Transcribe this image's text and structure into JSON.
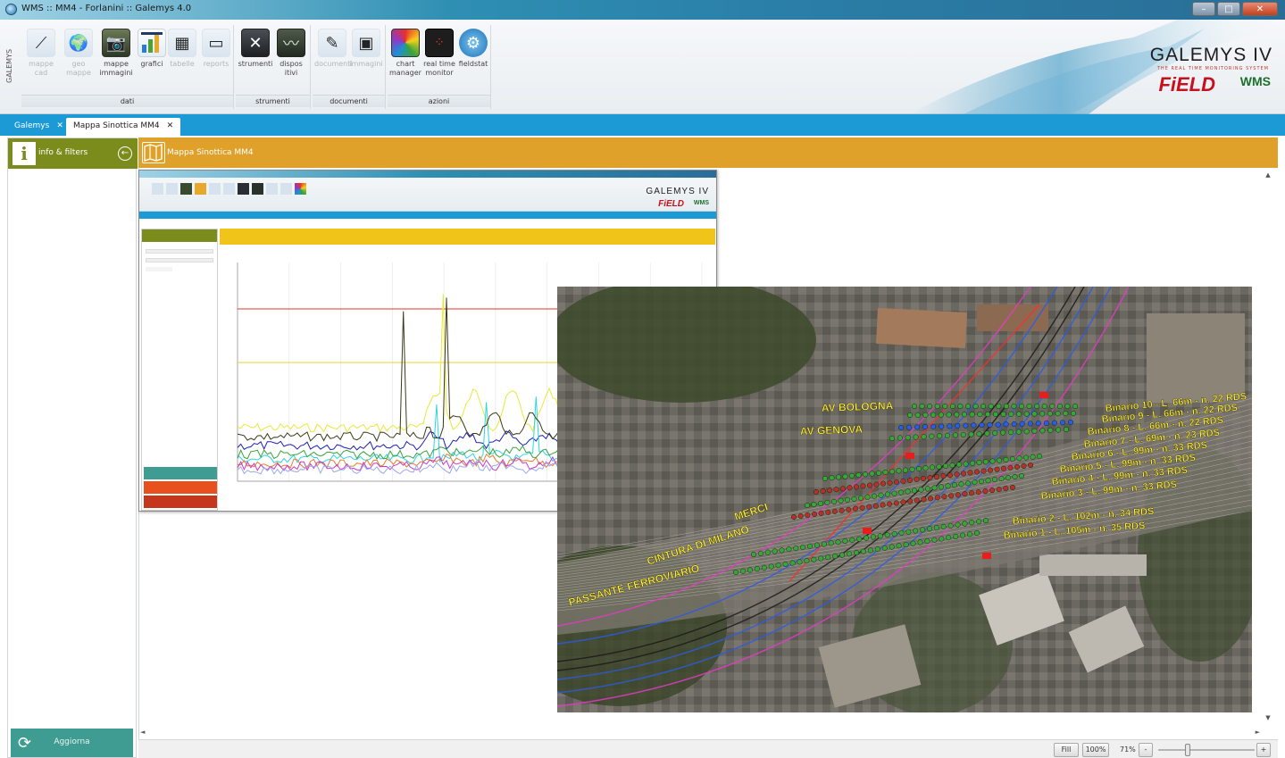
{
  "window": {
    "title": "WMS :: MM4 - Forlanini :: Galemys 4.0",
    "controls": {
      "minimize": "–",
      "maximize": "□",
      "close": "✕"
    }
  },
  "ribbon": {
    "side_label": "GALEMYS",
    "groups": [
      {
        "label": "dati",
        "buttons": [
          {
            "label": "mappe cad",
            "icon": "map-cad-icon",
            "enabled": false
          },
          {
            "label": "geo mappe",
            "icon": "geo-map-icon",
            "enabled": false
          },
          {
            "label": "mappe immagini",
            "icon": "camera-icon",
            "enabled": true
          },
          {
            "label": "grafici",
            "icon": "bar-chart-icon",
            "enabled": true
          },
          {
            "label": "tabelle",
            "icon": "table-icon",
            "enabled": false
          },
          {
            "label": "reports",
            "icon": "report-icon",
            "enabled": false
          }
        ]
      },
      {
        "label": "strumenti",
        "buttons": [
          {
            "label": "strumenti",
            "icon": "tools-icon",
            "enabled": true
          },
          {
            "label": "dispos itivi",
            "icon": "device-icon",
            "enabled": true
          }
        ]
      },
      {
        "label": "documenti",
        "buttons": [
          {
            "label": "documenti",
            "icon": "pencil-icon",
            "enabled": false
          },
          {
            "label": "immagini",
            "icon": "image-icon",
            "enabled": false
          }
        ]
      },
      {
        "label": "azioni",
        "buttons": [
          {
            "label": "chart manager",
            "icon": "color-palette-icon",
            "enabled": true
          },
          {
            "label": "real time monitor",
            "icon": "monitor-icon",
            "enabled": true
          },
          {
            "label": "fieldstat",
            "icon": "gear-icon",
            "enabled": true
          }
        ]
      }
    ]
  },
  "brand": {
    "title": "GALEMYS IV",
    "subtitle": "THE REAL TIME MONITORING SYSTEM",
    "field": "FiELD",
    "wms": "WMS"
  },
  "tabs": [
    {
      "label": "Galemys",
      "close": "✕",
      "active": false
    },
    {
      "label": "Mappa Sinottica MM4",
      "close": "✕",
      "active": true
    }
  ],
  "left_panel": {
    "header_icon": "i",
    "header_label": "info & filters",
    "back_icon": "←",
    "refresh_label": "Aggiorna"
  },
  "content": {
    "title": "Mappa Sinottica MM4"
  },
  "inset": {
    "brand_title": "GALEMYS IV",
    "brand_field": "FiELD",
    "brand_wms": "WMS",
    "chart_series_colors": [
      "#e8e83a",
      "#1e1eb8",
      "#2bd4e8",
      "#3a3a1a",
      "#e87d2b",
      "#3aa33a",
      "#c83ac8",
      "#9aa9e8"
    ],
    "red_threshold_color": "#e8302b",
    "yellow_threshold_color": "#e8d42b"
  },
  "map": {
    "labels": {
      "av_bologna": "AV BOLOGNA",
      "av_genova": "AV GENOVA",
      "merci": "MERCI",
      "cintura": "CINTURA DI MILANO",
      "passante": "PASSANTE FERROVIARIO"
    },
    "binari": [
      "Binario 10 - L. 66m - n. 22 RDS",
      "Binario 9 - L. 66m - n. 22 RDS",
      "Binario 8 - L. 66m - n. 22 RDS",
      "Binario 7 - L. 69m - n. 23 RDS",
      "Binario 6 - L. 99m - n. 33 RDS",
      "Binario 5 - L. 99m - n. 33 RDS",
      "Binario 4 - L. 99m - n. 33 RDS",
      "Binario 3 - L. 99m - n. 33 RDS",
      "Binario 2 - L. 102m - n. 34 RDS",
      "Binario 1 - L. 105m - n. 35 RDS"
    ]
  },
  "zoom": {
    "fill_label": "Fill",
    "hundred_label": "100%",
    "value": "71%",
    "minus": "-",
    "plus": "+",
    "slider_fraction": 0.3
  }
}
